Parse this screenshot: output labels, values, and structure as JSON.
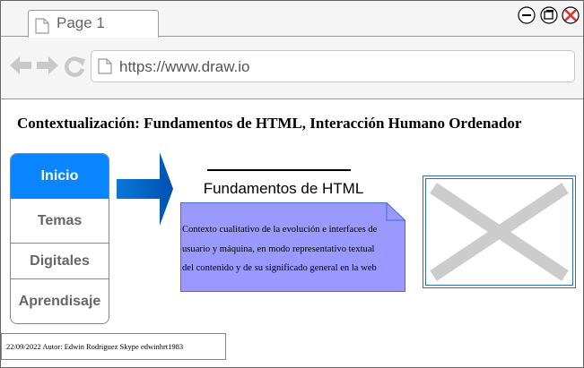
{
  "browser": {
    "tab": {
      "label": "Page 1",
      "icon": "document-icon"
    },
    "window_controls": [
      "minimize-icon",
      "restore-icon",
      "close-icon"
    ],
    "nav_icons": [
      "back-arrow-icon",
      "forward-arrow-icon",
      "reload-icon"
    ],
    "address": {
      "url": "https://www.draw.io",
      "icon": "document-icon"
    }
  },
  "page": {
    "heading": "Contextualización: Fundamentos de HTML, Interacción Humano Ordenador"
  },
  "menu": {
    "items": [
      {
        "label": "Inicio",
        "active": true
      },
      {
        "label": "Temas",
        "active": false
      },
      {
        "label": "Digitales",
        "active": false
      },
      {
        "label": "Aprendisaje",
        "active": false
      }
    ],
    "active_color": "#0985ff"
  },
  "content": {
    "title": "Fundamentos de HTML",
    "note": {
      "lines": [
        "Contexto cualitativo de la evolución e interfaces de",
        "usuario y máquina, en modo representativo textual",
        "del contenido y de su significado general en la web"
      ],
      "fill_color": "#9999ff",
      "border_color": "#3b6fd6"
    },
    "image_icon": "image-placeholder-icon"
  },
  "footer": {
    "text": "22/09/2022 Autor: Edwin Rodriguez Skype edwinhrt1983"
  },
  "colors": {
    "arrow": "#0066cc",
    "chrome_bg": "#f5f5f5"
  }
}
